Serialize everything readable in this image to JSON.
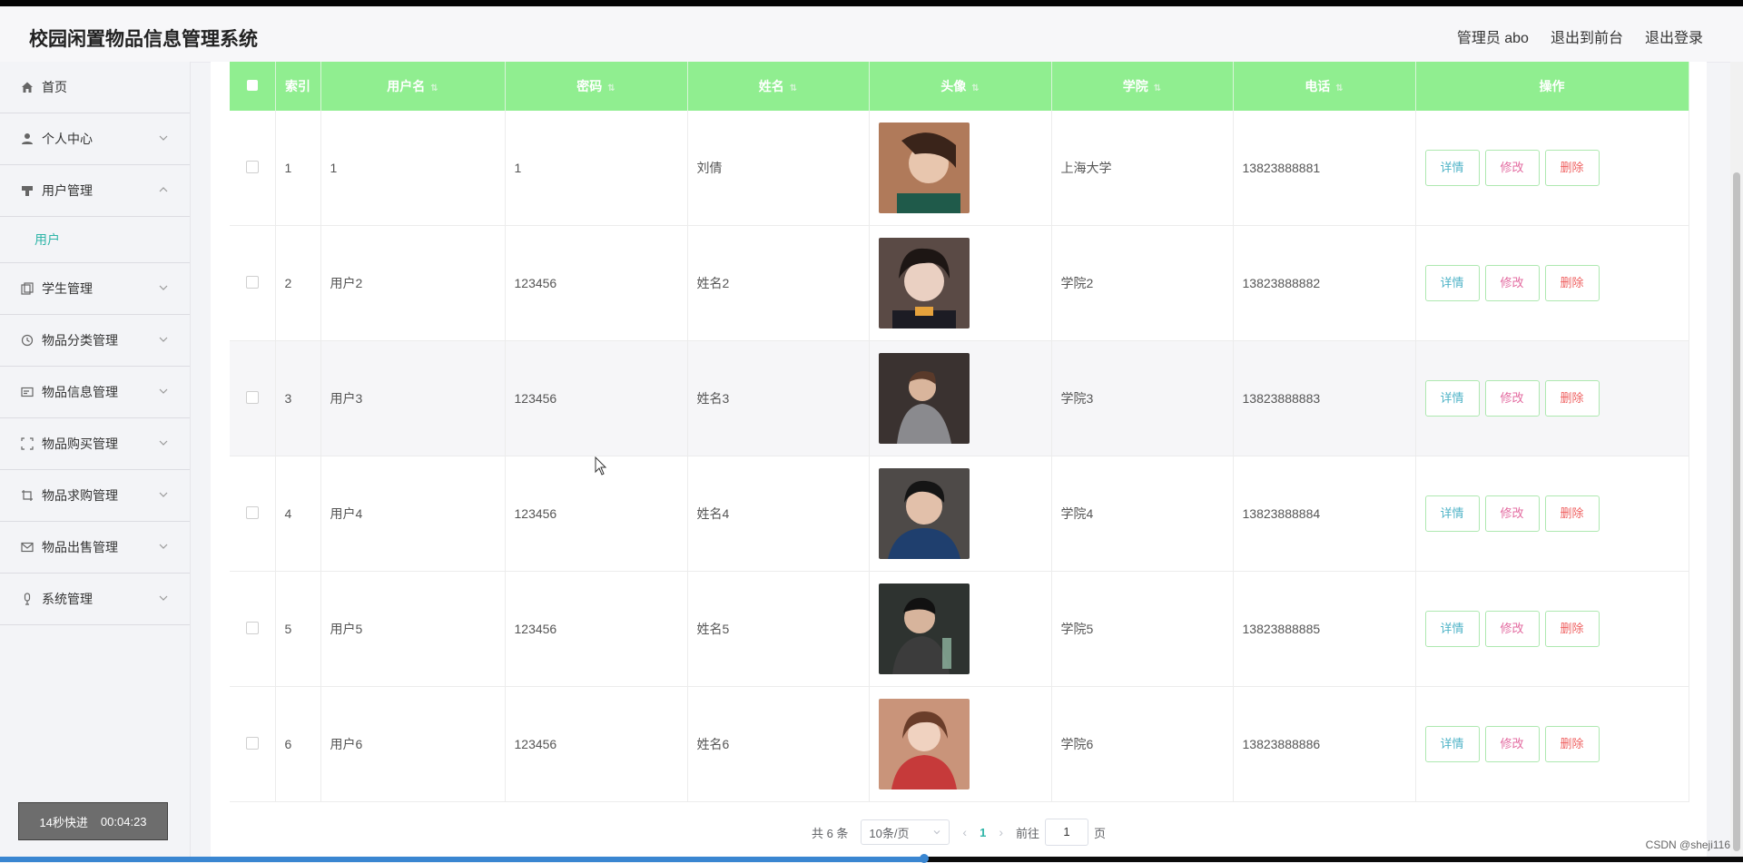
{
  "header": {
    "title": "校园闲置物品信息管理系统",
    "admin_label": "管理员 abo",
    "exit_front": "退出到前台",
    "logout": "退出登录"
  },
  "sidebar": {
    "items": [
      {
        "label": "首页",
        "icon": "home-icon"
      },
      {
        "label": "个人中心",
        "icon": "user-icon"
      },
      {
        "label": "用户管理",
        "icon": "user-manage-icon"
      },
      {
        "label": "学生管理",
        "icon": "copy-icon"
      },
      {
        "label": "物品分类管理",
        "icon": "clock-icon"
      },
      {
        "label": "物品信息管理",
        "icon": "card-icon"
      },
      {
        "label": "物品购买管理",
        "icon": "frame-icon"
      },
      {
        "label": "物品求购管理",
        "icon": "crop-icon"
      },
      {
        "label": "物品出售管理",
        "icon": "mail-icon"
      },
      {
        "label": "系统管理",
        "icon": "mic-icon"
      }
    ],
    "submenu_user": "用户"
  },
  "table": {
    "columns": [
      "索引",
      "用户名",
      "密码",
      "姓名",
      "头像",
      "学院",
      "电话",
      "操作"
    ],
    "rows": [
      {
        "index": "1",
        "username": "1",
        "password": "1",
        "name": "刘倩",
        "college": "上海大学",
        "phone": "13823888881",
        "avatar_color": "#b07a5a"
      },
      {
        "index": "2",
        "username": "用户2",
        "password": "123456",
        "name": "姓名2",
        "college": "学院2",
        "phone": "13823888882",
        "avatar_color": "#5a4a45"
      },
      {
        "index": "3",
        "username": "用户3",
        "password": "123456",
        "name": "姓名3",
        "college": "学院3",
        "phone": "13823888883",
        "avatar_color": "#4a4542"
      },
      {
        "index": "4",
        "username": "用户4",
        "password": "123456",
        "name": "姓名4",
        "college": "学院4",
        "phone": "13823888884",
        "avatar_color": "#3d4a5a"
      },
      {
        "index": "5",
        "username": "用户5",
        "password": "123456",
        "name": "姓名5",
        "college": "学院5",
        "phone": "13823888885",
        "avatar_color": "#3a3e3a"
      },
      {
        "index": "6",
        "username": "用户6",
        "password": "123456",
        "name": "姓名6",
        "college": "学院6",
        "phone": "13823888886",
        "avatar_color": "#c9947a"
      }
    ],
    "actions": {
      "detail": "详情",
      "edit": "修改",
      "delete": "删除"
    }
  },
  "pagination": {
    "total": "共 6 条",
    "page_size": "10条/页",
    "current_page": "1",
    "goto_prefix": "前往",
    "goto_value": "1",
    "goto_suffix": "页"
  },
  "fast_forward": {
    "label": "14秒快进",
    "time": "00:04:23"
  },
  "watermark": "CSDN @sheji116",
  "playback_progress": 0.53
}
